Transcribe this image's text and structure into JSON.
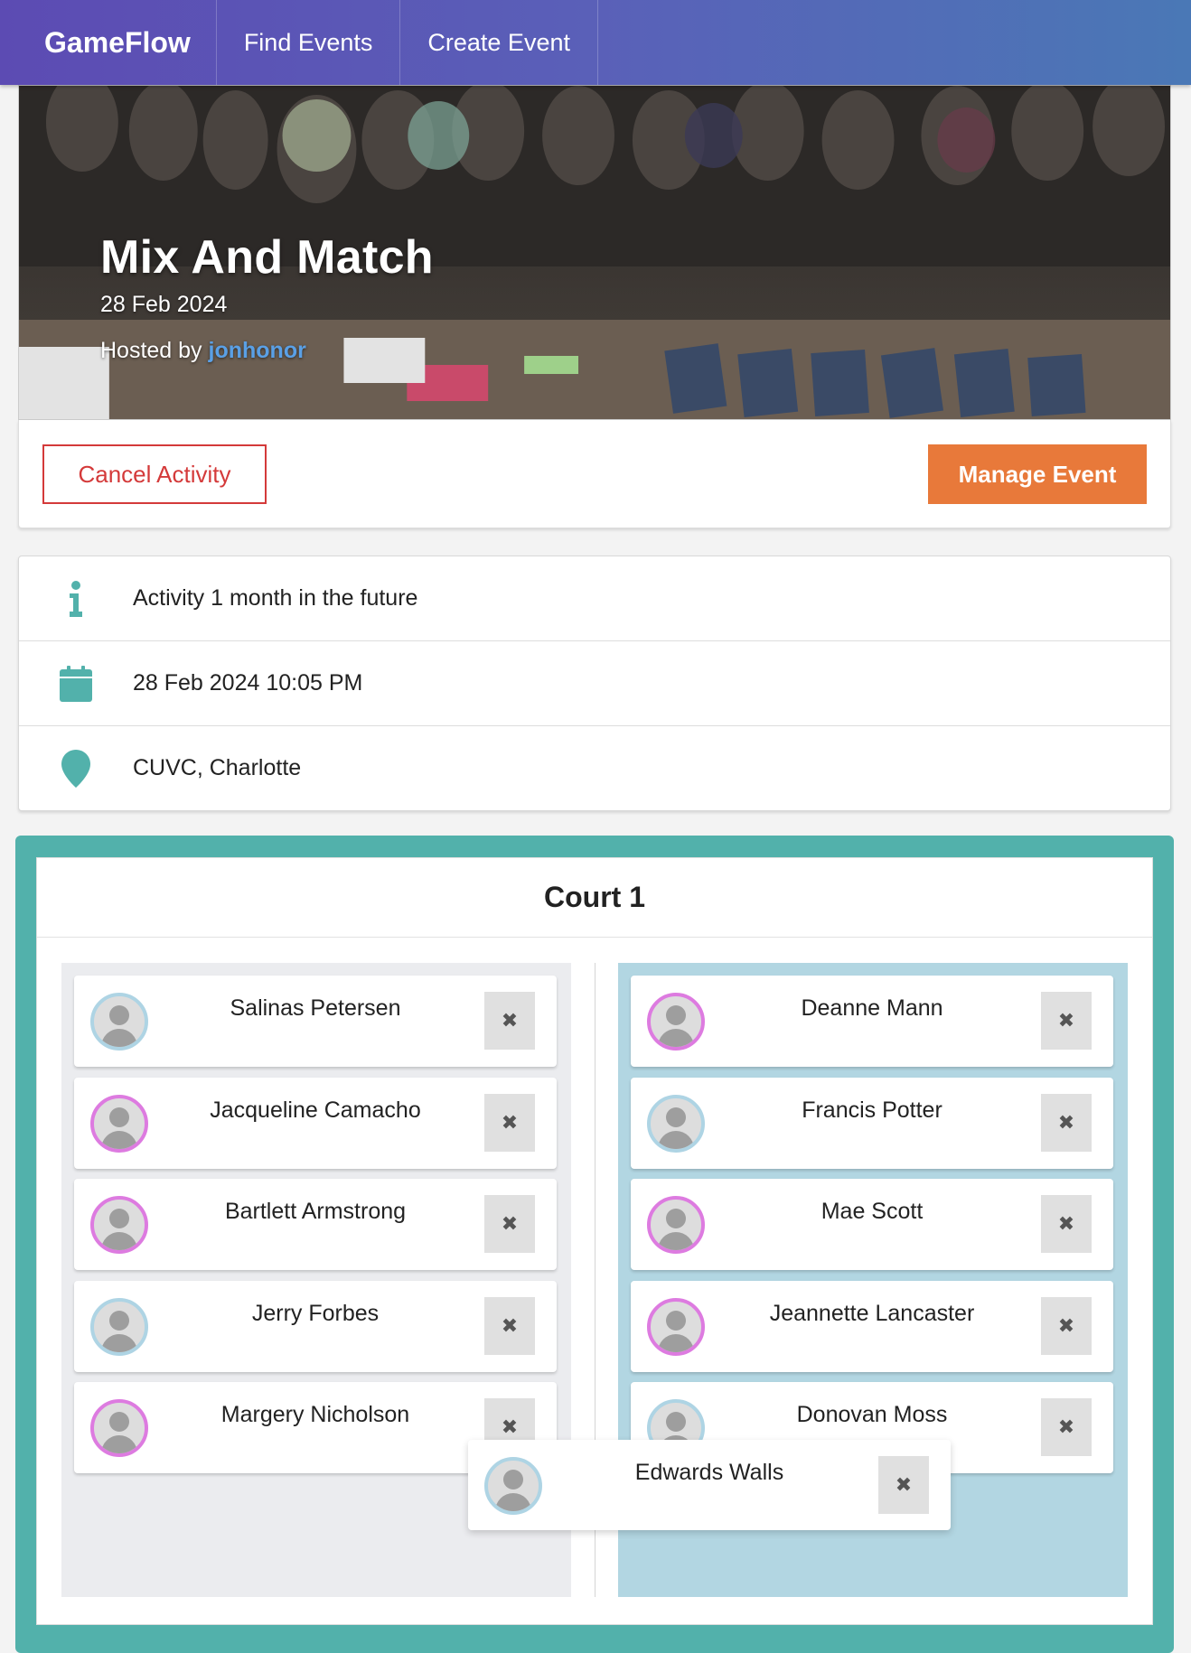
{
  "nav": {
    "brand": "GameFlow",
    "links": [
      "Find Events",
      "Create Event"
    ]
  },
  "event": {
    "title": "Mix And Match",
    "date": "28 Feb 2024",
    "hosted_by_label": "Hosted by",
    "host": "jonhonor"
  },
  "actions": {
    "cancel_label": "Cancel Activity",
    "manage_label": "Manage Event"
  },
  "info": [
    {
      "icon": "info-icon",
      "text": "Activity 1 month in the future"
    },
    {
      "icon": "calendar-icon",
      "text": "28 Feb 2024 10:05 PM"
    },
    {
      "icon": "location-pin-icon",
      "text": "CUVC, Charlotte"
    }
  ],
  "court": {
    "title": "Court 1",
    "team_a": [
      {
        "name": "Salinas Petersen",
        "ring": "blue"
      },
      {
        "name": "Jacqueline Camacho",
        "ring": "pink"
      },
      {
        "name": "Bartlett Armstrong",
        "ring": "pink"
      },
      {
        "name": "Jerry Forbes",
        "ring": "blue"
      },
      {
        "name": "Margery Nicholson",
        "ring": "pink"
      }
    ],
    "team_b": [
      {
        "name": "Deanne Mann",
        "ring": "pink"
      },
      {
        "name": "Francis Potter",
        "ring": "blue"
      },
      {
        "name": "Mae Scott",
        "ring": "pink"
      },
      {
        "name": "Jeannette Lancaster",
        "ring": "pink"
      },
      {
        "name": "Donovan Moss",
        "ring": "blue"
      }
    ],
    "dragging": {
      "name": "Edwards Walls",
      "ring": "blue"
    }
  },
  "colors": {
    "teal": "#52b1ab",
    "orange": "#e8793a",
    "danger": "#d43a3a",
    "ring_blue": "#aed4e4",
    "ring_pink": "#dd7be0",
    "team_b_bg": "#b2d6e2"
  }
}
